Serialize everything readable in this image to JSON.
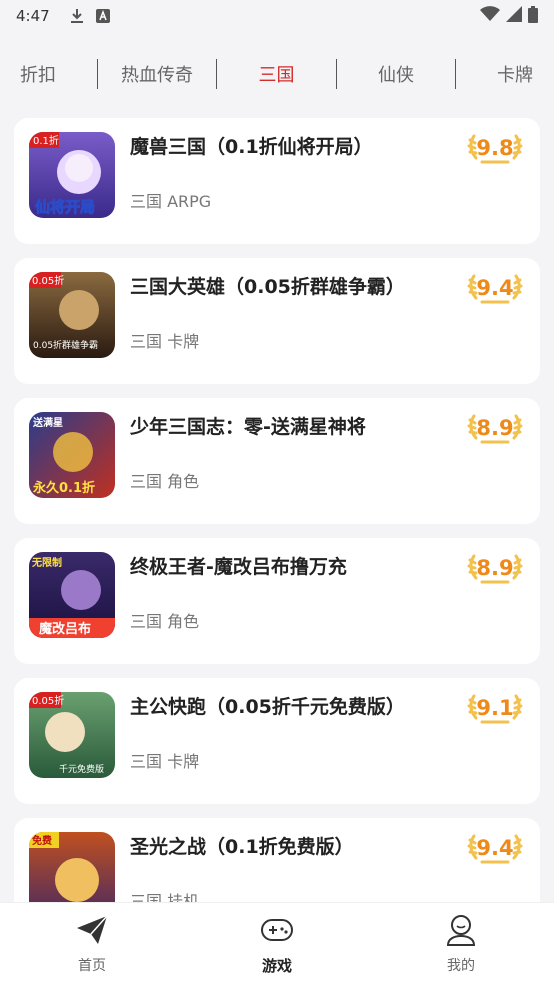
{
  "status_bar": {
    "time": "4:47"
  },
  "tabs": [
    {
      "label": "折扣",
      "active": false
    },
    {
      "label": "热血传奇",
      "active": false
    },
    {
      "label": "三国",
      "active": true
    },
    {
      "label": "仙侠",
      "active": false
    },
    {
      "label": "卡牌",
      "active": false
    }
  ],
  "games": [
    {
      "name": "魔兽三国（0.1折仙将开局）",
      "tags": "三国 ARPG",
      "rating": "9.8",
      "icon_colors": [
        "#7a5cc8",
        "#e8d8ff"
      ]
    },
    {
      "name": "三国大英雄（0.05折群雄争霸）",
      "tags": "三国 卡牌",
      "rating": "9.4",
      "icon_colors": [
        "#5a3a22",
        "#c9a36a"
      ]
    },
    {
      "name": "少年三国志：零-送满星神将",
      "tags": "三国 角色",
      "rating": "8.9",
      "icon_colors": [
        "#2a3c8c",
        "#f0c040"
      ]
    },
    {
      "name": "终极王者-魔改吕布撸万充",
      "tags": "三国 角色",
      "rating": "8.9",
      "icon_colors": [
        "#3a2a6a",
        "#f04030"
      ]
    },
    {
      "name": "主公快跑（0.05折千元免费版）",
      "tags": "三国 卡牌",
      "rating": "9.1",
      "icon_colors": [
        "#3f7a4a",
        "#f0e0c0"
      ]
    },
    {
      "name": "圣光之战（0.1折免费版）",
      "tags": "三国 挂机",
      "rating": "9.4",
      "icon_colors": [
        "#c05020",
        "#f0c060"
      ]
    }
  ],
  "icon_badges": [
    "0.1折",
    "0.05折",
    "送满星",
    "无限制",
    "0.05折",
    "免费"
  ],
  "icon_captions": [
    "仙将开局",
    "0.05折群雄争霸",
    "永久0.1折",
    "魔改吕布",
    "千元免费版",
    ""
  ],
  "bottom_nav": [
    {
      "label": "首页",
      "icon": "paper-plane-icon",
      "active": false
    },
    {
      "label": "游戏",
      "icon": "gamepad-icon",
      "active": true
    },
    {
      "label": "我的",
      "icon": "user-icon",
      "active": false
    }
  ],
  "colors": {
    "accent": "#d12b2b",
    "rating": "#ee8a1a",
    "laurel": "#f2c14e"
  }
}
